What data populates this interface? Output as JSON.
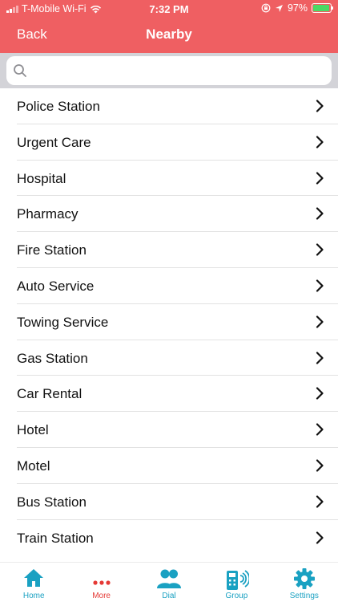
{
  "status_bar": {
    "carrier": "T-Mobile Wi-Fi",
    "time": "7:32 PM",
    "battery": "97%",
    "battery_level": 0.97
  },
  "header": {
    "back_label": "Back",
    "title": "Nearby",
    "color": "#ef5f62"
  },
  "search": {
    "placeholder": "",
    "value": ""
  },
  "list": {
    "items": [
      {
        "label": "Police Station"
      },
      {
        "label": "Urgent Care"
      },
      {
        "label": "Hospital"
      },
      {
        "label": "Pharmacy"
      },
      {
        "label": "Fire Station"
      },
      {
        "label": "Auto Service"
      },
      {
        "label": "Towing Service"
      },
      {
        "label": "Gas Station"
      },
      {
        "label": "Car Rental"
      },
      {
        "label": "Hotel"
      },
      {
        "label": "Motel"
      },
      {
        "label": "Bus Station"
      },
      {
        "label": "Train Station"
      }
    ]
  },
  "tabbar": {
    "tabs": [
      {
        "label": "Home",
        "icon": "home-icon"
      },
      {
        "label": "More",
        "icon": "more-icon",
        "active": true
      },
      {
        "label": "Dial",
        "icon": "people-icon"
      },
      {
        "label": "Group",
        "icon": "walkie-talkie-icon"
      },
      {
        "label": "Settings",
        "icon": "gear-icon"
      }
    ],
    "accent_color": "#1aa1c2",
    "active_color": "#e53935"
  }
}
